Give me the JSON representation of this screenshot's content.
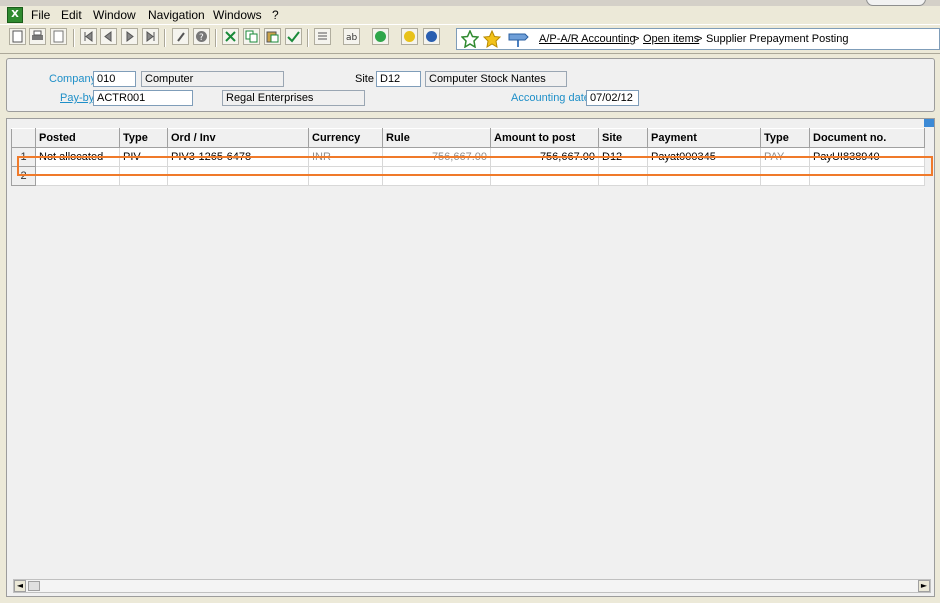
{
  "menu": {
    "file": "File",
    "edit": "Edit",
    "window": "Window",
    "navigation": "Navigation",
    "windows": "Windows",
    "help": "?"
  },
  "breadcrumb": {
    "crumb1": "A/P-A/R Accounting",
    "sep": ">",
    "crumb2": "Open items",
    "crumb3": "Supplier Prepayment Posting"
  },
  "header": {
    "company_label": "Company",
    "company_code": "010",
    "company_name": "Computer",
    "site_label": "Site",
    "site_code": "D12",
    "site_name": "Computer Stock Nantes",
    "payby_label": "Pay-by",
    "payby_code": "ACTR001",
    "payby_name": "Regal Enterprises",
    "accdate_label": "Accounting date",
    "accdate_value": "07/02/12"
  },
  "grid": {
    "columns": [
      "Posted",
      "Type",
      "Ord / Inv",
      "Currency",
      "Rule",
      "Amount to post",
      "Site",
      "Payment",
      "Type",
      "Document no."
    ],
    "rows": [
      {
        "num": "1",
        "posted": "Not allocated",
        "type": "PIV",
        "ordinv": "PIV3-1265-6478",
        "currency": "INR",
        "rule": "756,667.00",
        "amount": "756,667.00",
        "site": "D12",
        "payment": "Payat000345",
        "type2": "PAY",
        "docno": "PayUI838940"
      },
      {
        "num": "2",
        "posted": "",
        "type": "",
        "ordinv": "",
        "currency": "",
        "rule": "",
        "amount": "",
        "site": "",
        "payment": "",
        "type2": "",
        "docno": ""
      }
    ]
  },
  "colors": {
    "accent_label": "#1e8fc8",
    "selection_border": "#f07a2a"
  }
}
